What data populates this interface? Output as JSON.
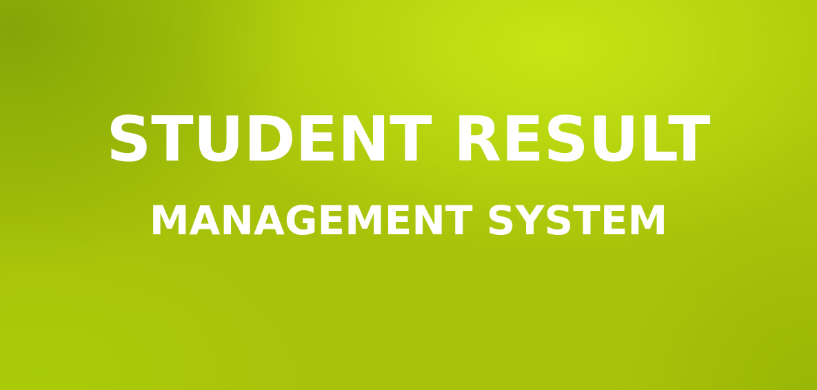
{
  "banner": {
    "title_line_1": "STUDENT RESULT",
    "title_line_2": "MANAGEMENT SYSTEM"
  },
  "colors": {
    "background": "#a9c30a",
    "highlight": "#c5e818",
    "text": "#ffffff"
  }
}
